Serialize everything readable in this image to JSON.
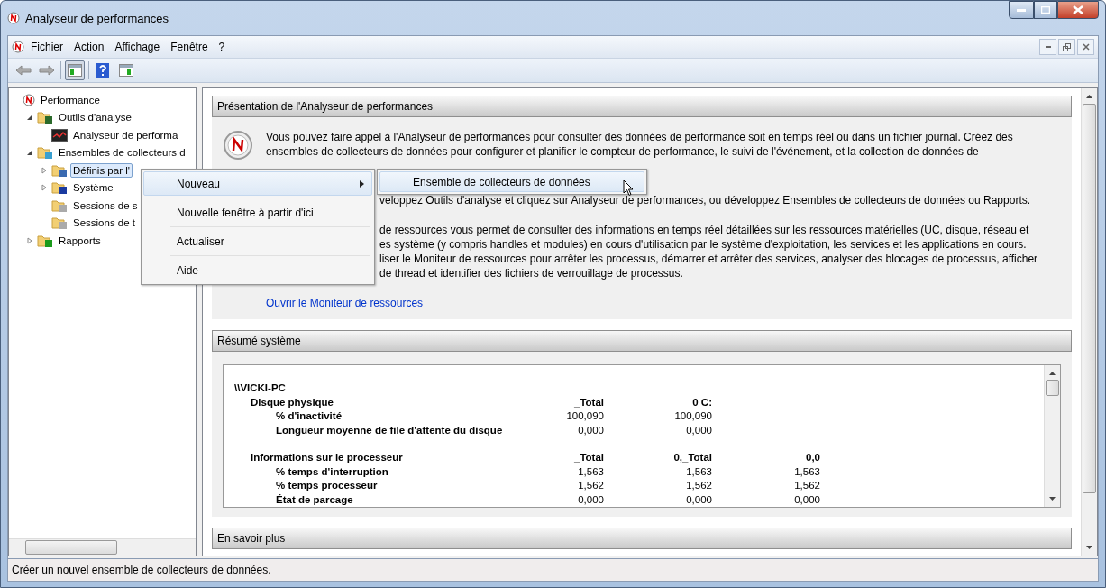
{
  "window": {
    "title": "Analyseur de performances"
  },
  "menu_bar": [
    "Fichier",
    "Action",
    "Affichage",
    "Fenêtre",
    "?"
  ],
  "toolbar": {
    "tree_button_pressed": true
  },
  "tree": [
    {
      "label": "Performance",
      "kind": "root",
      "selected": false,
      "children": [
        {
          "label": "Outils d'analyse",
          "kind": "tools",
          "expanded": true,
          "selected": false,
          "children": [
            {
              "label": "Analyseur de performa",
              "kind": "monitor",
              "selected": false
            }
          ]
        },
        {
          "label": "Ensembles de collecteurs d",
          "kind": "sets",
          "expanded": true,
          "selected": false,
          "children": [
            {
              "label": "Définis par l'",
              "kind": "user",
              "expanded": false,
              "selected": true
            },
            {
              "label": "Système",
              "kind": "system",
              "expanded": false,
              "selected": false
            },
            {
              "label": "Sessions de s",
              "kind": "session",
              "selected": false
            },
            {
              "label": "Sessions de t",
              "kind": "session",
              "selected": false
            }
          ]
        },
        {
          "label": "Rapports",
          "kind": "reports",
          "expanded": false,
          "selected": false
        }
      ]
    }
  ],
  "context_menu": {
    "items": [
      {
        "label": "Nouveau",
        "has_submenu": true,
        "selected": true
      },
      {
        "label": "Nouvelle fenêtre à partir d'ici",
        "has_submenu": false,
        "selected": false
      },
      {
        "label": "Actualiser",
        "has_submenu": false,
        "selected": false
      },
      {
        "label": "Aide",
        "has_submenu": false,
        "selected": false
      }
    ],
    "submenu": [
      {
        "label": "Ensemble de collecteurs de données",
        "selected": true
      }
    ]
  },
  "overview": {
    "title": "Présentation de l'Analyseur de performances",
    "paragraph_1": "Vous pouvez faire appel à l'Analyseur de performances pour consulter des données de performance soit en temps réel ou dans un fichier journal. Créez des ensembles de collecteurs de données pour configurer et planifier le compteur de performance, le suivi de l'événement, et la collection de données de",
    "paragraph_2": "veloppez Outils d'analyse et cliquez sur Analyseur de performances, ou développez Ensembles de collecteurs de données ou Rapports.",
    "paragraph_3": [
      "de ressources vous permet de consulter des informations en temps réel détaillées sur les ressources matérielles (UC, disque, réseau et",
      "es système (y compris handles et modules) en cours d'utilisation par le système d'exploitation, les services et les applications en cours.",
      "liser le Moniteur de ressources pour arrêter les processus, démarrer et arrêter des services, analyser des blocages de processus, afficher",
      "de thread et identifier des fichiers de verrouillage de processus."
    ],
    "link": "Ouvrir le Moniteur de ressources"
  },
  "summary": {
    "title": "Résumé système",
    "rows": [
      {
        "kind": "host",
        "label": "\\\\VICKI-PC",
        "cells": []
      },
      {
        "kind": "group",
        "label": "Disque physique",
        "cells": [
          "_Total",
          "0 C:"
        ]
      },
      {
        "kind": "counter",
        "label": "% d'inactivité",
        "cells": [
          "100,090",
          "100,090"
        ]
      },
      {
        "kind": "counter",
        "label": "Longueur moyenne de file d'attente du disque",
        "cells": [
          "0,000",
          "0,000"
        ]
      },
      {
        "kind": "spacer",
        "label": "",
        "cells": []
      },
      {
        "kind": "group",
        "label": "Informations sur le processeur",
        "cells": [
          "_Total",
          "0,_Total",
          "0,0"
        ]
      },
      {
        "kind": "counter",
        "label": "% temps d'interruption",
        "cells": [
          "1,563",
          "1,563",
          "1,563"
        ]
      },
      {
        "kind": "counter",
        "label": "% temps processeur",
        "cells": [
          "1,562",
          "1,562",
          "1,562"
        ]
      },
      {
        "kind": "counter",
        "label": "État de parcage",
        "cells": [
          "0,000",
          "0,000",
          "0,000"
        ]
      }
    ]
  },
  "learn_more": {
    "title": "En savoir plus"
  },
  "status_bar": "Créer un nouvel ensemble de collecteurs de données."
}
